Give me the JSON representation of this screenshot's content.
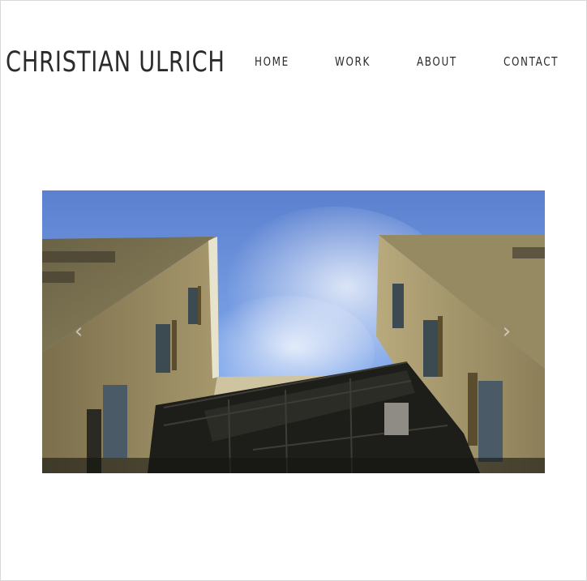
{
  "site": {
    "title": "CHRISTIAN ULRICH"
  },
  "nav": {
    "items": [
      "HOME",
      "WORK",
      "ABOUT",
      "CONTACT"
    ]
  },
  "hero": {
    "alt": "Looking up between two brick buildings with a fire escape against a blue sky",
    "prev_icon": "chevron-left-icon",
    "next_icon": "chevron-right-icon",
    "prev_glyph": "‹",
    "next_glyph": "›"
  },
  "colors": {
    "text": "#2b2b2b",
    "sky": "#6f97e0",
    "brick": "#8a7c58"
  }
}
